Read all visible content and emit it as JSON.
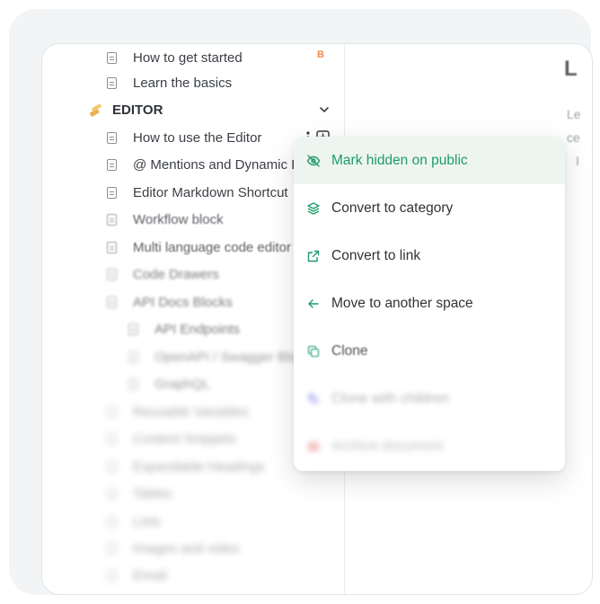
{
  "sidebar": {
    "top_items": [
      {
        "label": "How to get started",
        "badge": "B"
      },
      {
        "label": "Learn the basics"
      }
    ],
    "section": {
      "title": "EDITOR"
    },
    "items": [
      "How to use the Editor",
      "@ Mentions and Dynamic I",
      "Editor Markdown Shortcut",
      "Workflow block",
      "Multi language code editor",
      "Code Drawers",
      "API Docs Blocks",
      "API Endpoints",
      "OpenAPI / Swagger Blo",
      "GraphQL",
      "Reusable Variables",
      "Content Snippets",
      "Expandable Headings",
      "Tables",
      "Lists",
      "Images and video",
      "Email"
    ]
  },
  "content": {
    "letters": [
      "L",
      "Le",
      "ce",
      "I"
    ]
  },
  "context_menu": {
    "items": [
      {
        "label": "Mark hidden on public",
        "icon": "eye-off-icon"
      },
      {
        "label": "Convert to category",
        "icon": "layers-icon"
      },
      {
        "label": "Convert to link",
        "icon": "external-link-icon"
      },
      {
        "label": "Move to another space",
        "icon": "arrow-left-icon"
      },
      {
        "label": "Clone",
        "icon": "copy-icon"
      },
      {
        "label": "Clone with children",
        "icon": "copy-children-icon"
      },
      {
        "label": "Archive document",
        "icon": "archive-icon"
      }
    ]
  },
  "colors": {
    "accent": "#1f9a6a",
    "highlight_bg": "#eef5f1",
    "badge": "#f08a4b",
    "clone_children_icon": "#8d8cf0",
    "archive_icon": "#e66a6a"
  }
}
